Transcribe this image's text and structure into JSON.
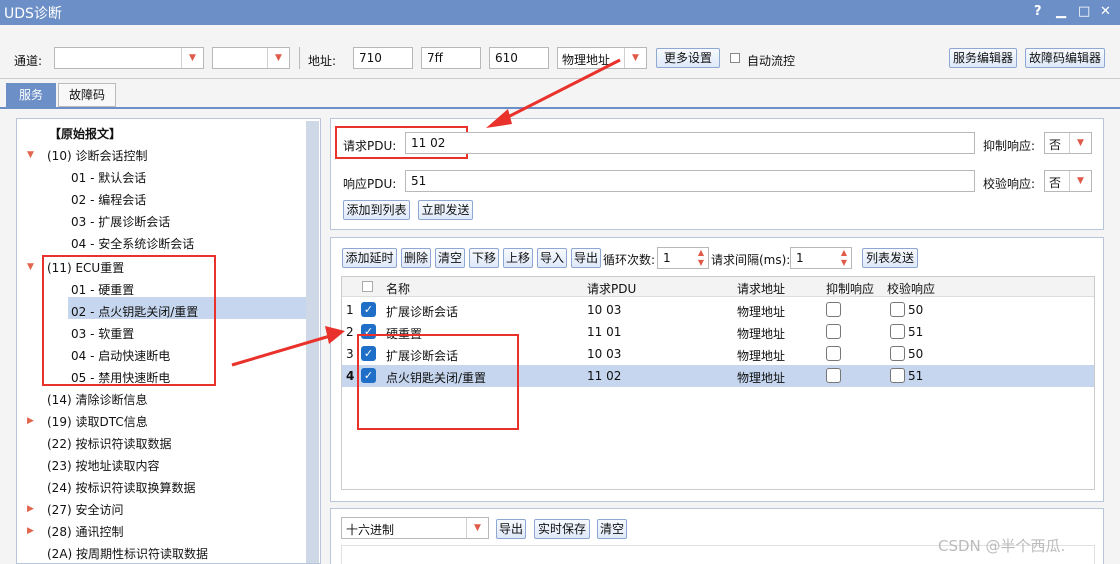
{
  "window": {
    "title": "UDS诊断",
    "help": "?",
    "minimize": "▁",
    "maximize": "□",
    "close": "✕"
  },
  "toolbar": {
    "channel_label": "通道:",
    "address_label": "地址:",
    "addr1": "710",
    "addr2": "7ff",
    "addr3": "610",
    "addr_type": "物理地址",
    "more_settings": "更多设置",
    "auto_flow_label": "自动流控",
    "service_editor": "服务编辑器",
    "dtc_editor": "故障码编辑器"
  },
  "tabs": [
    {
      "label": "服务"
    },
    {
      "label": "故障码"
    }
  ],
  "tree": {
    "raw": "【原始报文】",
    "items": [
      {
        "label": "(10) 诊断会话控制"
      },
      {
        "label": "01 - 默认会话"
      },
      {
        "label": "02 - 编程会话"
      },
      {
        "label": "03 - 扩展诊断会话"
      },
      {
        "label": "04 - 安全系统诊断会话"
      },
      {
        "label": "(11) ECU重置"
      },
      {
        "label": "01 - 硬重置"
      },
      {
        "label": "02 - 点火钥匙关闭/重置"
      },
      {
        "label": "03 - 软重置"
      },
      {
        "label": "04 - 启动快速断电"
      },
      {
        "label": "05 - 禁用快速断电"
      },
      {
        "label": "(14) 清除诊断信息"
      },
      {
        "label": "(19) 读取DTC信息"
      },
      {
        "label": "(22) 按标识符读取数据"
      },
      {
        "label": "(23) 按地址读取内容"
      },
      {
        "label": "(24) 按标识符读取换算数据"
      },
      {
        "label": "(27) 安全访问"
      },
      {
        "label": "(28) 通讯控制"
      },
      {
        "label": "(2A) 按周期性标识符读取数据"
      }
    ]
  },
  "request": {
    "req_label": "请求PDU:",
    "req_value": "11 02",
    "resp_label": "响应PDU:",
    "resp_value": "51",
    "suppress_label": "抑制响应:",
    "suppress_value": "否",
    "verify_label": "校验响应:",
    "verify_value": "否",
    "add_to_list": "添加到列表",
    "send_now": "立即发送"
  },
  "list_toolbar": {
    "add_delay": "添加延时",
    "delete": "删除",
    "clear": "清空",
    "move_down": "下移",
    "move_up": "上移",
    "import": "导入",
    "export": "导出",
    "loop_label": "循环次数:",
    "loop_value": "1",
    "interval_label": "请求间隔(ms):",
    "interval_value": "1",
    "list_send": "列表发送"
  },
  "grid": {
    "headers": {
      "name": "名称",
      "pdu": "请求PDU",
      "addr": "请求地址",
      "suppress": "抑制响应",
      "verify": "校验响应"
    },
    "rows": [
      {
        "no": "1",
        "name": "扩展诊断会话",
        "pdu": "10 03",
        "addr": "物理地址",
        "verify": "50"
      },
      {
        "no": "2",
        "name": "硬重置",
        "pdu": "11 01",
        "addr": "物理地址",
        "verify": "51"
      },
      {
        "no": "3",
        "name": "扩展诊断会话",
        "pdu": "10 03",
        "addr": "物理地址",
        "verify": "50"
      },
      {
        "no": "4",
        "name": "点火钥匙关闭/重置",
        "pdu": "11 02",
        "addr": "物理地址",
        "verify": "51"
      }
    ]
  },
  "output": {
    "format": "十六进制",
    "export": "导出",
    "realtime_save": "实时保存",
    "clear": "清空"
  },
  "watermark": "CSDN @半个西瓜.",
  "colors": {
    "accent": "#6d8fc7",
    "selected": "#c5d6ee",
    "annotation": "#e8322b",
    "checkbox": "#1f6fc8"
  }
}
